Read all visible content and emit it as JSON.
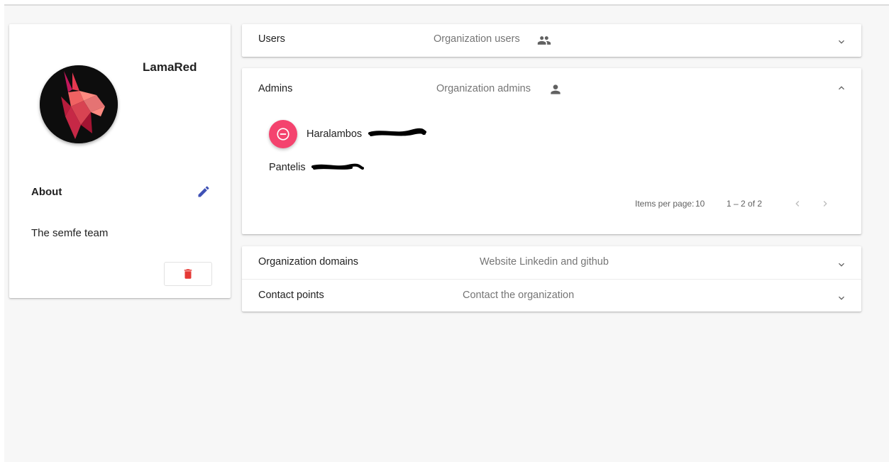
{
  "profile": {
    "org_name": "LamaRed",
    "about_label": "About",
    "about_text": "The semfe team",
    "icons": {
      "edit": "edit-pencil-icon",
      "delete": "trash-icon",
      "avatar": "llama-logo"
    }
  },
  "panels": {
    "users": {
      "title": "Users",
      "description": "Organization users",
      "icon": "group-icon",
      "state": "collapsed"
    },
    "admins": {
      "title": "Admins",
      "description": "Organization admins",
      "icon": "person-icon",
      "state": "expanded",
      "members": [
        {
          "name": "Haralambos",
          "surname_redacted": true
        },
        {
          "name": "Pantelis",
          "surname_redacted": true
        }
      ],
      "paginator": {
        "items_per_page_label": "Items per page:",
        "items_per_page": "10",
        "range": "1 – 2 of 2"
      }
    },
    "domains": {
      "title": "Organization domains",
      "description": "Website Linkedin and github",
      "state": "collapsed"
    },
    "contact": {
      "title": "Contact points",
      "description": "Contact the organization",
      "state": "collapsed"
    }
  },
  "colors": {
    "accent_pink": "#f4436e",
    "edit_blue": "#3f51b5",
    "delete_red": "#e53935",
    "muted_text": "#757575",
    "background": "#f7f7f7"
  }
}
